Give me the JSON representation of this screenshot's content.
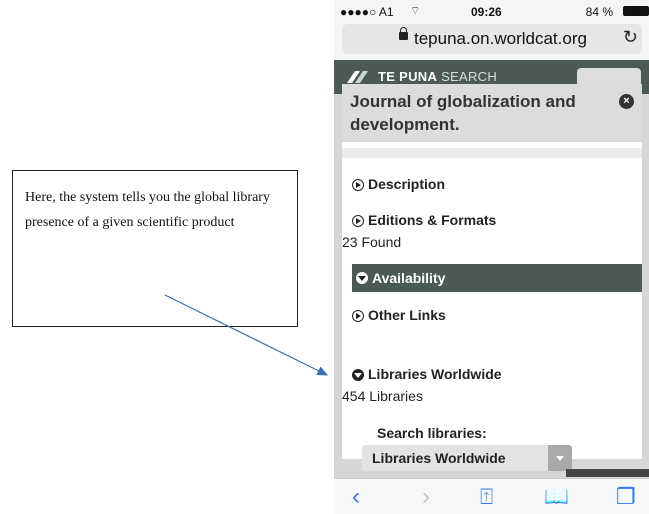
{
  "annotation": {
    "text": "Here, the system tells you the global library presence of a given scientific product"
  },
  "status_bar": {
    "carrier": "●●●●○ A1 ",
    "wifi_icon": "wifi-icon",
    "time": "09:26",
    "battery": "84 %"
  },
  "browser": {
    "url": "tepuna.on.worldcat.org",
    "reload_glyph": "↻"
  },
  "site": {
    "name_bold": "TE PUNA",
    "name_light": " SEARCH"
  },
  "panel": {
    "title": "Journal of globalization and development.",
    "close_glyph": "×",
    "sections": {
      "description": "Description",
      "editions": "Editions & Formats",
      "editions_count": "23 Found",
      "availability": "Availability",
      "other_links": "Other Links",
      "libraries": "Libraries Worldwide",
      "libraries_count": "454 Libraries"
    },
    "search_libraries_label": "Search libraries:",
    "search_libraries_selected": "Libraries Worldwide"
  },
  "toolbar": {
    "back": "‹",
    "forward": "›",
    "share": "⍐",
    "bookmarks": "📖",
    "tabs": "❐"
  },
  "colors": {
    "header_green": "#4b5a53",
    "ios_blue": "#2f7af6"
  }
}
